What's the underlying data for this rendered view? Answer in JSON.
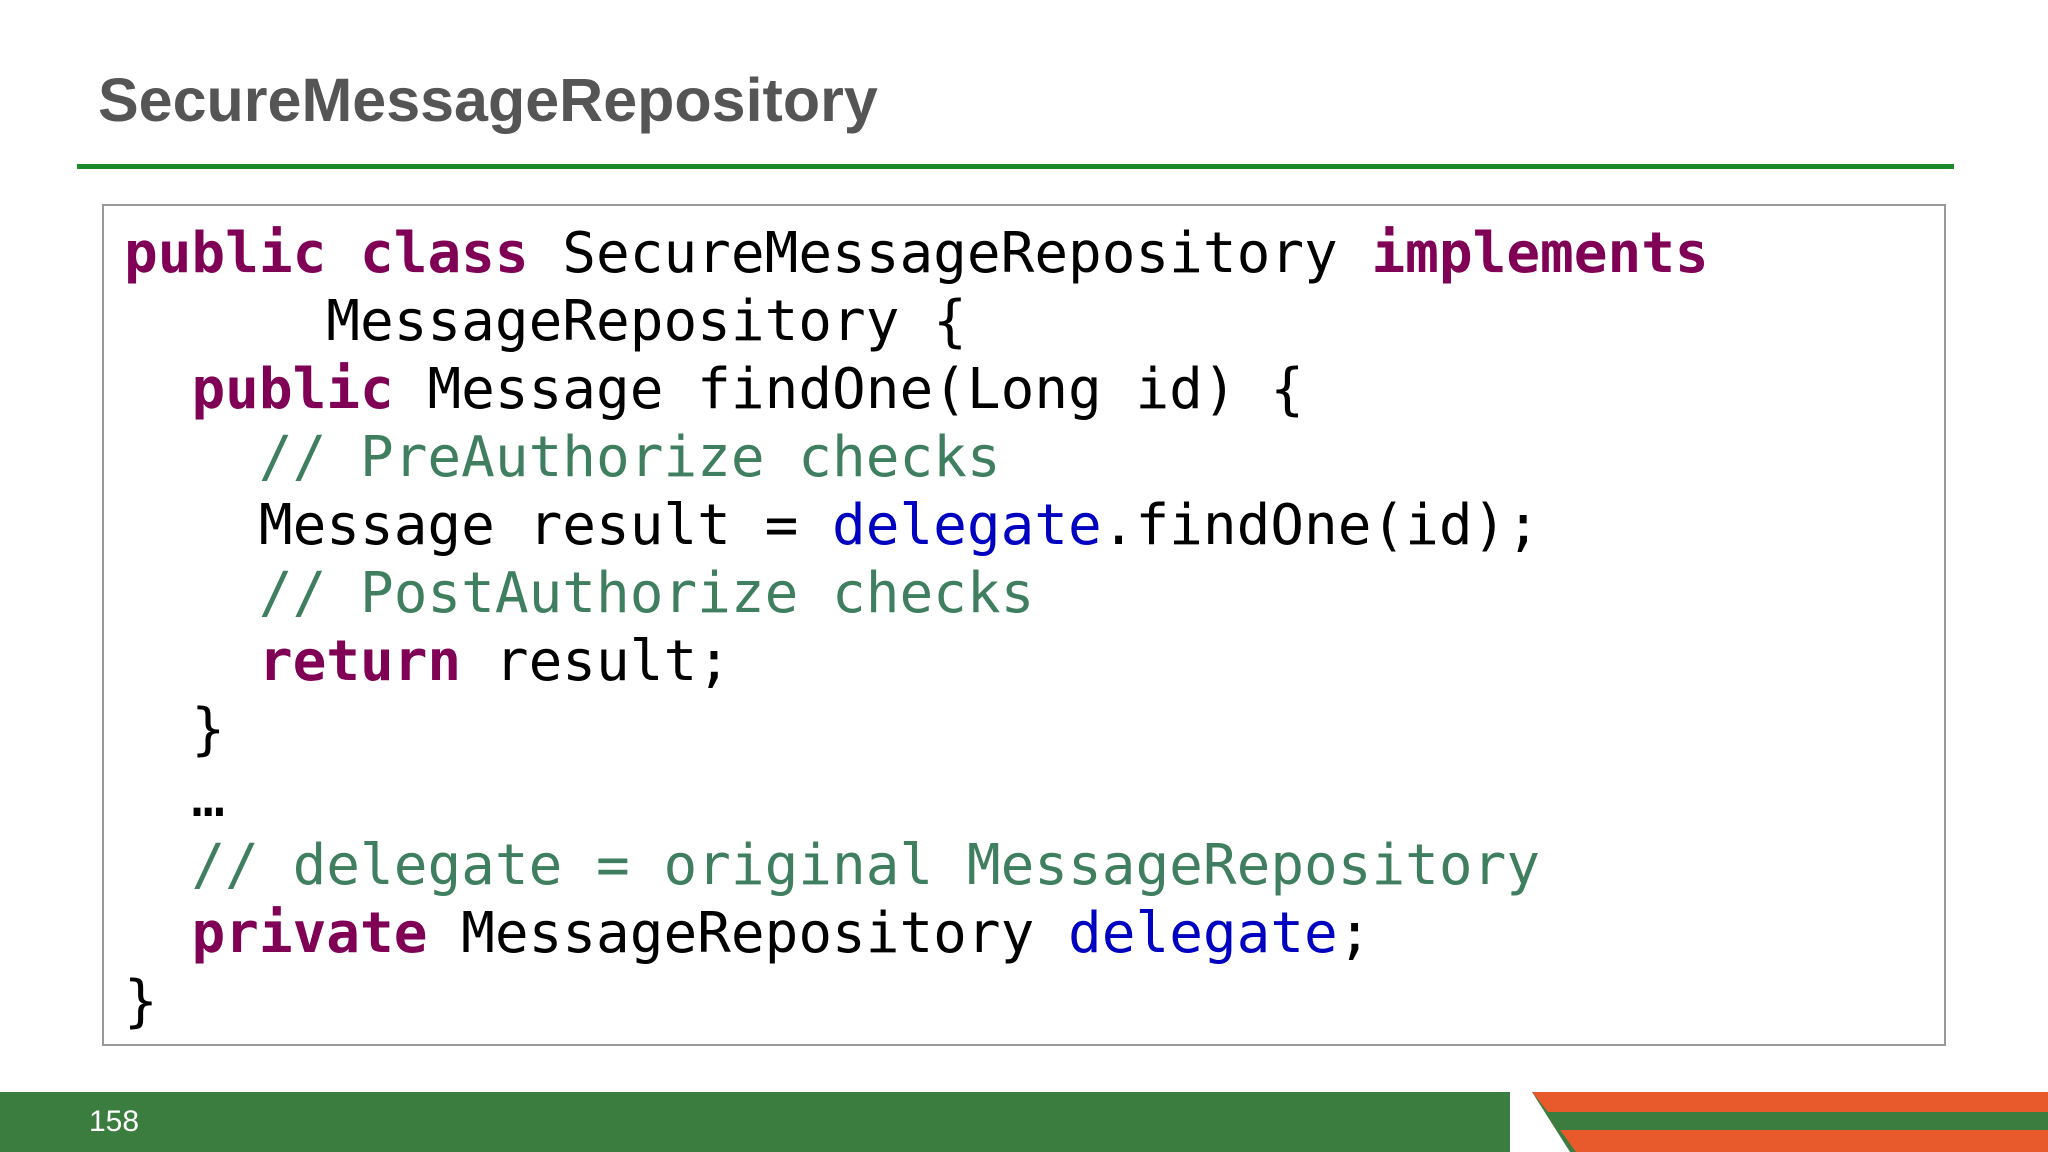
{
  "slide": {
    "title": "SecureMessageRepository",
    "page_number": "158"
  },
  "code": {
    "lines": [
      [
        {
          "type": "kw",
          "text": "public"
        },
        {
          "type": "plain",
          "text": " "
        },
        {
          "type": "kw",
          "text": "class"
        },
        {
          "type": "plain",
          "text": " SecureMessageRepository "
        },
        {
          "type": "kw",
          "text": "implements"
        }
      ],
      [
        {
          "type": "plain",
          "text": "      MessageRepository {"
        }
      ],
      [
        {
          "type": "plain",
          "text": "  "
        },
        {
          "type": "kw",
          "text": "public"
        },
        {
          "type": "plain",
          "text": " Message findOne(Long id) {"
        }
      ],
      [
        {
          "type": "plain",
          "text": "    "
        },
        {
          "type": "comment",
          "text": "// PreAuthorize checks"
        }
      ],
      [
        {
          "type": "plain",
          "text": "    Message result = "
        },
        {
          "type": "field",
          "text": "delegate"
        },
        {
          "type": "plain",
          "text": ".findOne(id);"
        }
      ],
      [
        {
          "type": "plain",
          "text": "    "
        },
        {
          "type": "comment",
          "text": "// PostAuthorize checks"
        }
      ],
      [
        {
          "type": "plain",
          "text": "    "
        },
        {
          "type": "kw",
          "text": "return"
        },
        {
          "type": "plain",
          "text": " result;"
        }
      ],
      [
        {
          "type": "plain",
          "text": "  }"
        }
      ],
      [
        {
          "type": "plain",
          "text": "  …"
        }
      ],
      [
        {
          "type": "plain",
          "text": "  "
        },
        {
          "type": "comment",
          "text": "// delegate = original MessageRepository"
        }
      ],
      [
        {
          "type": "plain",
          "text": "  "
        },
        {
          "type": "kw",
          "text": "private"
        },
        {
          "type": "plain",
          "text": " MessageRepository "
        },
        {
          "type": "field",
          "text": "delegate"
        },
        {
          "type": "plain",
          "text": ";"
        }
      ],
      [
        {
          "type": "plain",
          "text": "}"
        }
      ]
    ]
  },
  "colors": {
    "keyword": "#7f0055",
    "field": "#0000c0",
    "comment": "#3f7f5f",
    "title_rule": "#1a8a2b",
    "footer_green": "#3a7d3e",
    "footer_orange": "#e85a2b"
  }
}
